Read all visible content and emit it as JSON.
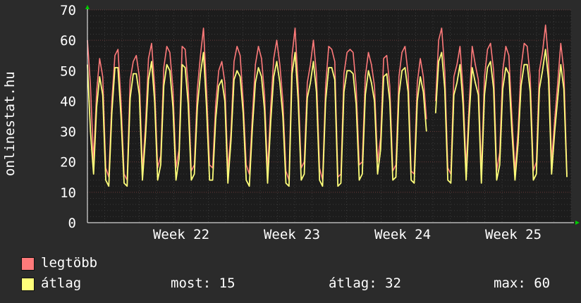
{
  "chart_data": {
    "type": "line",
    "ylabel": "onlinestat.hu",
    "ylim": [
      0,
      70
    ],
    "y_ticks": [
      "0",
      "10",
      "20",
      "30",
      "40",
      "50",
      "60",
      "70"
    ],
    "x_ticks": [
      "Week 22",
      "Week 23",
      "Week 24",
      "Week 25"
    ],
    "grid": true,
    "legend_placement": "bottom-left",
    "series": [
      {
        "name": "legtöbb",
        "color": "#ff7a7a",
        "values": [
          60,
          45,
          20,
          43,
          54,
          48,
          18,
          15,
          40,
          55,
          57,
          40,
          16,
          14,
          47,
          53,
          55,
          48,
          17,
          32,
          54,
          59,
          45,
          18,
          22,
          51,
          58,
          56,
          44,
          18,
          24,
          58,
          57,
          45,
          17,
          19,
          44,
          55,
          64,
          44,
          19,
          18,
          39,
          50,
          53,
          46,
          17,
          30,
          53,
          58,
          55,
          40,
          19,
          16,
          35,
          52,
          58,
          54,
          42,
          17,
          38,
          54,
          60,
          52,
          40,
          17,
          14,
          55,
          64,
          45,
          18,
          20,
          46,
          52,
          60,
          49,
          18,
          14,
          45,
          58,
          57,
          53,
          15,
          16,
          49,
          56,
          57,
          56,
          45,
          19,
          20,
          48,
          56,
          52,
          45,
          20,
          28,
          54,
          55,
          45,
          17,
          19,
          48,
          56,
          58,
          49,
          17,
          16,
          46,
          54,
          48,
          34,
          null,
          null,
          40,
          60,
          64,
          50,
          18,
          16,
          48,
          52,
          58,
          44,
          18,
          39,
          58,
          52,
          47,
          16,
          48,
          57,
          59,
          50,
          17,
          23,
          50,
          58,
          55,
          35,
          17,
          30,
          51,
          59,
          58,
          48,
          17,
          20,
          50,
          56,
          65,
          53,
          20,
          34,
          46,
          59,
          50,
          16
        ]
      },
      {
        "name": "átlag",
        "color": "#ffff7a",
        "values": [
          52,
          30,
          16,
          38,
          48,
          42,
          14,
          12,
          36,
          51,
          51,
          35,
          13,
          12,
          41,
          49,
          49,
          42,
          14,
          28,
          47,
          53,
          40,
          14,
          19,
          45,
          52,
          50,
          38,
          14,
          21,
          52,
          51,
          39,
          14,
          16,
          38,
          49,
          56,
          38,
          14,
          14,
          34,
          45,
          47,
          40,
          13,
          27,
          47,
          50,
          48,
          36,
          14,
          12,
          31,
          46,
          51,
          48,
          37,
          13,
          33,
          48,
          53,
          46,
          35,
          13,
          12,
          49,
          56,
          40,
          14,
          16,
          41,
          46,
          53,
          43,
          14,
          12,
          40,
          51,
          51,
          47,
          12,
          13,
          43,
          50,
          50,
          49,
          39,
          14,
          16,
          42,
          50,
          46,
          40,
          16,
          24,
          48,
          49,
          40,
          14,
          15,
          42,
          50,
          51,
          43,
          14,
          13,
          40,
          48,
          43,
          30,
          null,
          null,
          36,
          53,
          56,
          44,
          14,
          13,
          42,
          46,
          52,
          39,
          14,
          35,
          51,
          46,
          42,
          13,
          42,
          51,
          53,
          44,
          14,
          19,
          44,
          51,
          49,
          30,
          14,
          26,
          45,
          52,
          52,
          43,
          14,
          16,
          44,
          50,
          57,
          47,
          16,
          30,
          41,
          52,
          44,
          15
        ]
      }
    ]
  },
  "legend": {
    "items": [
      {
        "label": "legtöbb",
        "color": "#ff7a7a"
      },
      {
        "label": "átlag",
        "color": "#ffff7a"
      }
    ],
    "stats": {
      "now": "most: 15",
      "avg": "átlag: 32",
      "max": "max: 60"
    }
  }
}
